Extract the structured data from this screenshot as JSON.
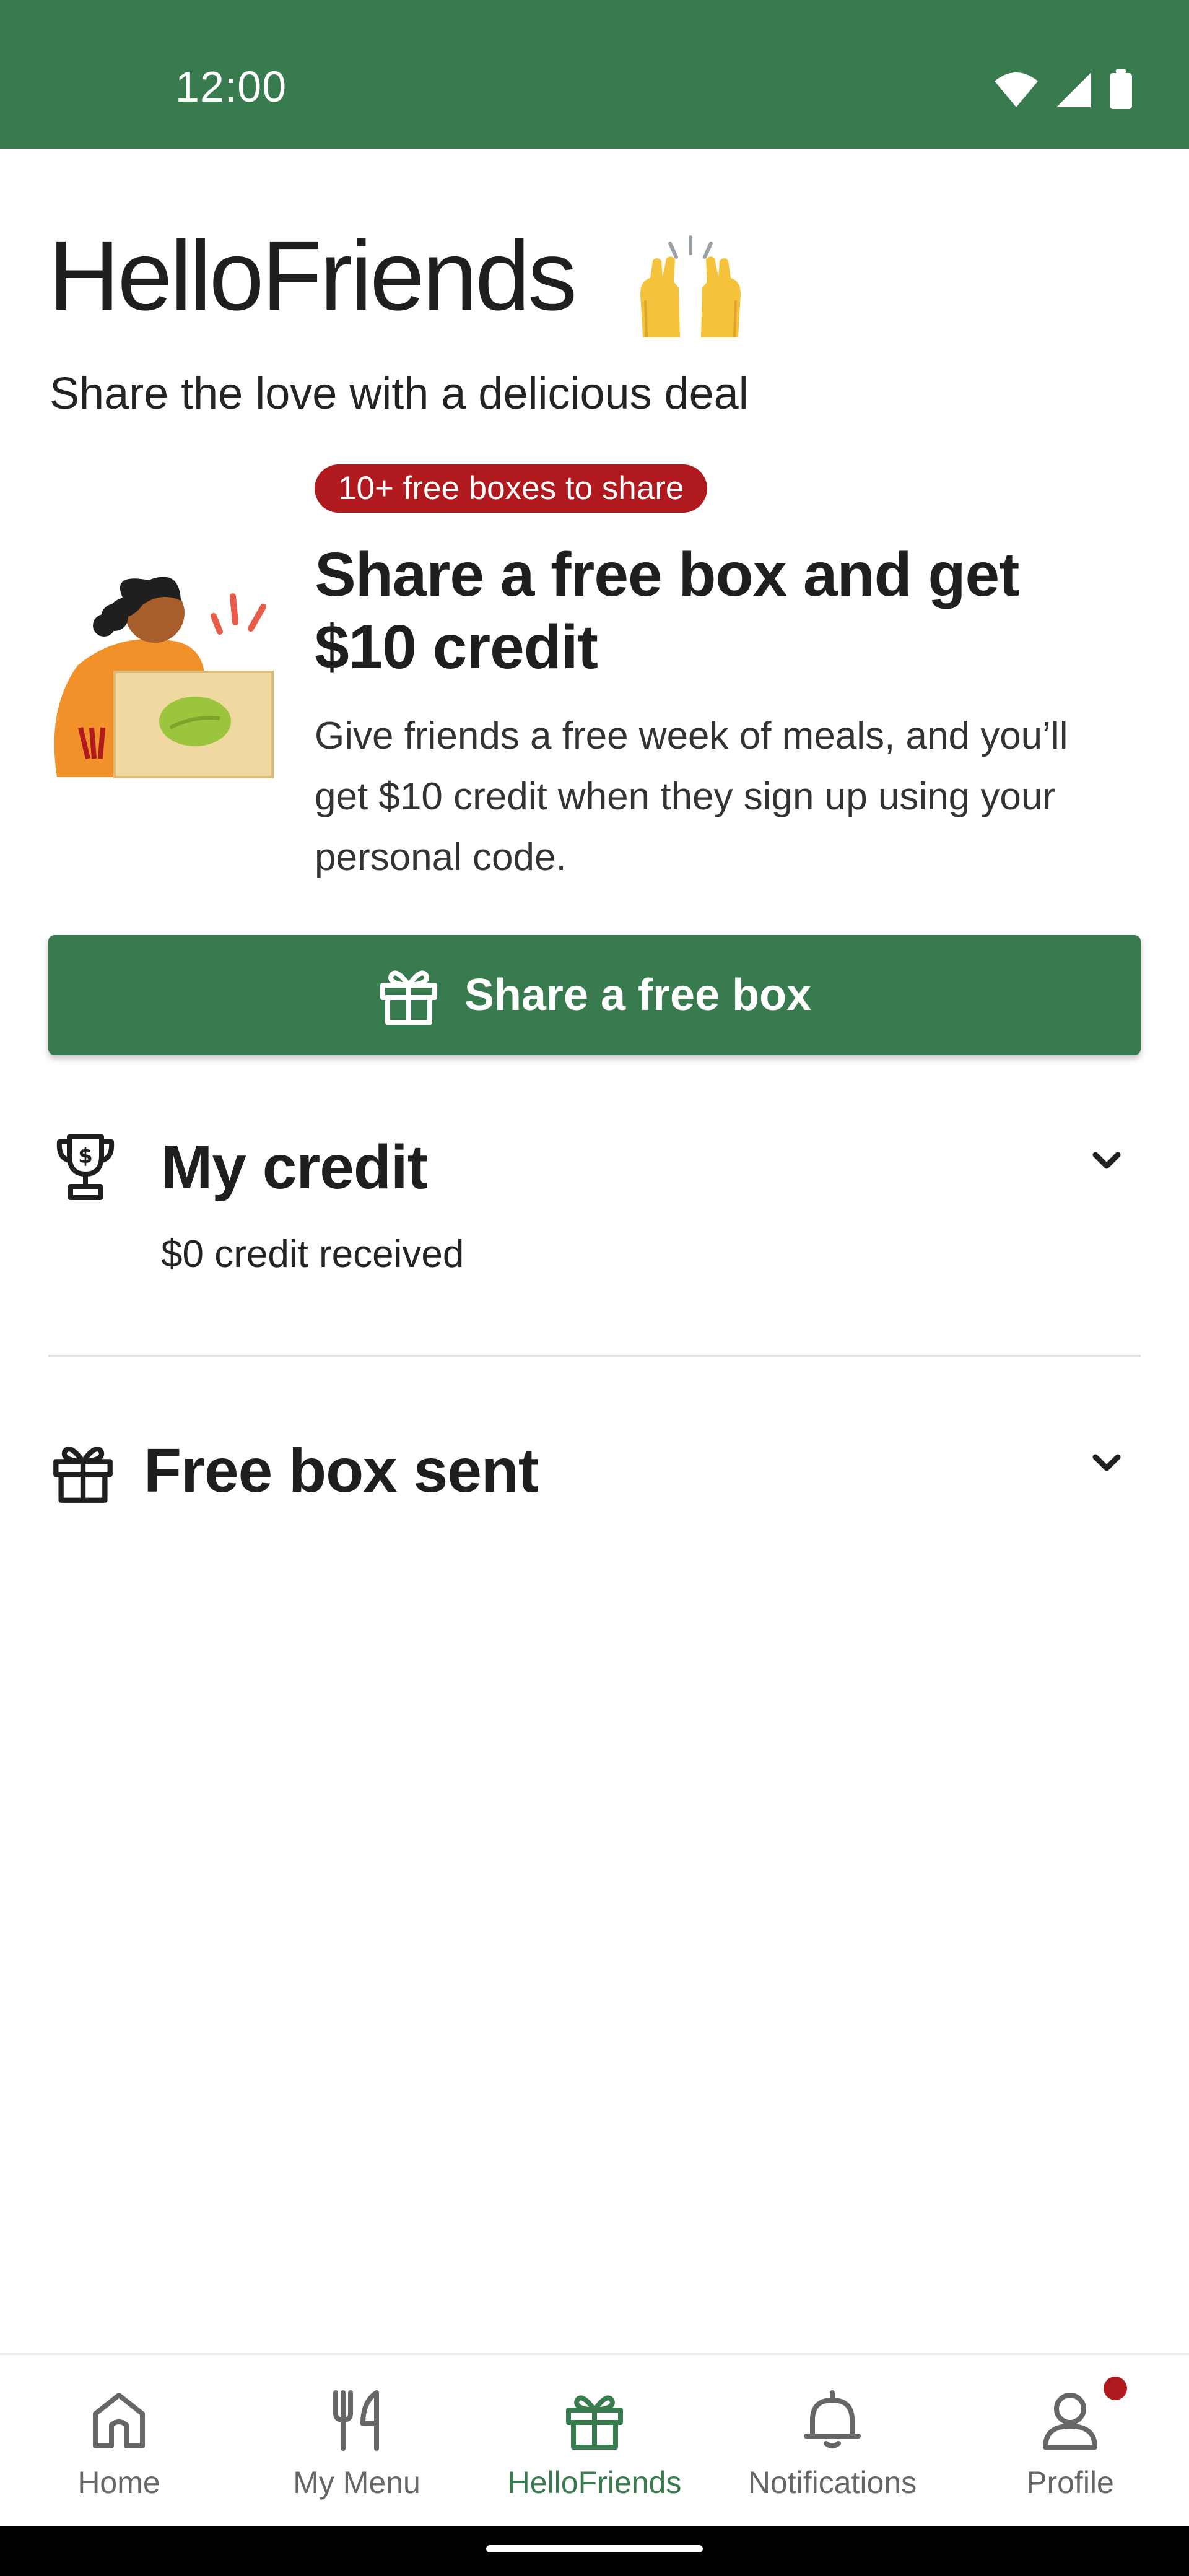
{
  "status_bar": {
    "time": "12:00",
    "icons": [
      "wifi-icon",
      "signal-icon",
      "battery-icon"
    ],
    "background": "#377b4f"
  },
  "header": {
    "title": "HelloFriends",
    "emoji": "raising-hands-emoji",
    "subtitle": "Share the love with a delicious deal"
  },
  "promo": {
    "badge": "10+ free boxes to share",
    "heading": "Share a free box and get $10 credit",
    "body": "Give friends a free week of meals, and you’ll get $10 credit when they sign up using your personal code.",
    "illustration": "person-holding-box-illustration"
  },
  "cta": {
    "label": "Share a free box",
    "icon": "gift-icon",
    "color": "#377b4f"
  },
  "credit": {
    "heading": "My credit",
    "value": "$0 credit received",
    "icon": "trophy-icon"
  },
  "free_box": {
    "heading": "Free box sent",
    "icon": "gift-icon"
  },
  "bottom_nav": {
    "items": [
      {
        "label": "Home",
        "icon": "home-icon",
        "active": false
      },
      {
        "label": "My Menu",
        "icon": "fork-knife-icon",
        "active": false
      },
      {
        "label": "HelloFriends",
        "icon": "gift-icon",
        "active": true
      },
      {
        "label": "Notifications",
        "icon": "bell-icon",
        "active": false
      },
      {
        "label": "Profile",
        "icon": "person-icon",
        "active": false,
        "badge": "notification-dot"
      }
    ],
    "active_color": "#377b4f",
    "badge_color": "#b0191e"
  }
}
